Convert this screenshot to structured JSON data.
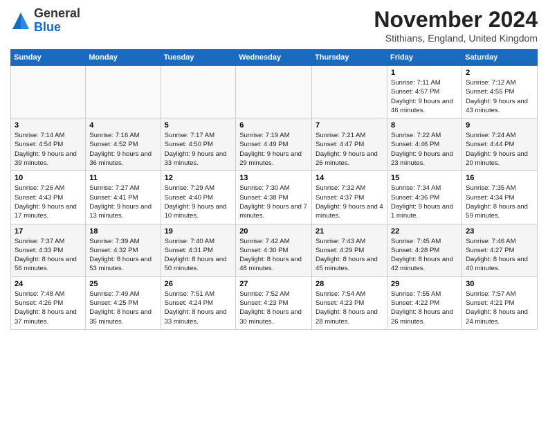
{
  "logo": {
    "general": "General",
    "blue": "Blue"
  },
  "header": {
    "month": "November 2024",
    "location": "Stithians, England, United Kingdom"
  },
  "days_of_week": [
    "Sunday",
    "Monday",
    "Tuesday",
    "Wednesday",
    "Thursday",
    "Friday",
    "Saturday"
  ],
  "weeks": [
    [
      {
        "day": "",
        "info": ""
      },
      {
        "day": "",
        "info": ""
      },
      {
        "day": "",
        "info": ""
      },
      {
        "day": "",
        "info": ""
      },
      {
        "day": "",
        "info": ""
      },
      {
        "day": "1",
        "info": "Sunrise: 7:11 AM\nSunset: 4:57 PM\nDaylight: 9 hours and 46 minutes."
      },
      {
        "day": "2",
        "info": "Sunrise: 7:12 AM\nSunset: 4:55 PM\nDaylight: 9 hours and 43 minutes."
      }
    ],
    [
      {
        "day": "3",
        "info": "Sunrise: 7:14 AM\nSunset: 4:54 PM\nDaylight: 9 hours and 39 minutes."
      },
      {
        "day": "4",
        "info": "Sunrise: 7:16 AM\nSunset: 4:52 PM\nDaylight: 9 hours and 36 minutes."
      },
      {
        "day": "5",
        "info": "Sunrise: 7:17 AM\nSunset: 4:50 PM\nDaylight: 9 hours and 33 minutes."
      },
      {
        "day": "6",
        "info": "Sunrise: 7:19 AM\nSunset: 4:49 PM\nDaylight: 9 hours and 29 minutes."
      },
      {
        "day": "7",
        "info": "Sunrise: 7:21 AM\nSunset: 4:47 PM\nDaylight: 9 hours and 26 minutes."
      },
      {
        "day": "8",
        "info": "Sunrise: 7:22 AM\nSunset: 4:46 PM\nDaylight: 9 hours and 23 minutes."
      },
      {
        "day": "9",
        "info": "Sunrise: 7:24 AM\nSunset: 4:44 PM\nDaylight: 9 hours and 20 minutes."
      }
    ],
    [
      {
        "day": "10",
        "info": "Sunrise: 7:26 AM\nSunset: 4:43 PM\nDaylight: 9 hours and 17 minutes."
      },
      {
        "day": "11",
        "info": "Sunrise: 7:27 AM\nSunset: 4:41 PM\nDaylight: 9 hours and 13 minutes."
      },
      {
        "day": "12",
        "info": "Sunrise: 7:29 AM\nSunset: 4:40 PM\nDaylight: 9 hours and 10 minutes."
      },
      {
        "day": "13",
        "info": "Sunrise: 7:30 AM\nSunset: 4:38 PM\nDaylight: 9 hours and 7 minutes."
      },
      {
        "day": "14",
        "info": "Sunrise: 7:32 AM\nSunset: 4:37 PM\nDaylight: 9 hours and 4 minutes."
      },
      {
        "day": "15",
        "info": "Sunrise: 7:34 AM\nSunset: 4:36 PM\nDaylight: 9 hours and 1 minute."
      },
      {
        "day": "16",
        "info": "Sunrise: 7:35 AM\nSunset: 4:34 PM\nDaylight: 8 hours and 59 minutes."
      }
    ],
    [
      {
        "day": "17",
        "info": "Sunrise: 7:37 AM\nSunset: 4:33 PM\nDaylight: 8 hours and 56 minutes."
      },
      {
        "day": "18",
        "info": "Sunrise: 7:39 AM\nSunset: 4:32 PM\nDaylight: 8 hours and 53 minutes."
      },
      {
        "day": "19",
        "info": "Sunrise: 7:40 AM\nSunset: 4:31 PM\nDaylight: 8 hours and 50 minutes."
      },
      {
        "day": "20",
        "info": "Sunrise: 7:42 AM\nSunset: 4:30 PM\nDaylight: 8 hours and 48 minutes."
      },
      {
        "day": "21",
        "info": "Sunrise: 7:43 AM\nSunset: 4:29 PM\nDaylight: 8 hours and 45 minutes."
      },
      {
        "day": "22",
        "info": "Sunrise: 7:45 AM\nSunset: 4:28 PM\nDaylight: 8 hours and 42 minutes."
      },
      {
        "day": "23",
        "info": "Sunrise: 7:46 AM\nSunset: 4:27 PM\nDaylight: 8 hours and 40 minutes."
      }
    ],
    [
      {
        "day": "24",
        "info": "Sunrise: 7:48 AM\nSunset: 4:26 PM\nDaylight: 8 hours and 37 minutes."
      },
      {
        "day": "25",
        "info": "Sunrise: 7:49 AM\nSunset: 4:25 PM\nDaylight: 8 hours and 35 minutes."
      },
      {
        "day": "26",
        "info": "Sunrise: 7:51 AM\nSunset: 4:24 PM\nDaylight: 8 hours and 33 minutes."
      },
      {
        "day": "27",
        "info": "Sunrise: 7:52 AM\nSunset: 4:23 PM\nDaylight: 8 hours and 30 minutes."
      },
      {
        "day": "28",
        "info": "Sunrise: 7:54 AM\nSunset: 4:23 PM\nDaylight: 8 hours and 28 minutes."
      },
      {
        "day": "29",
        "info": "Sunrise: 7:55 AM\nSunset: 4:22 PM\nDaylight: 8 hours and 26 minutes."
      },
      {
        "day": "30",
        "info": "Sunrise: 7:57 AM\nSunset: 4:21 PM\nDaylight: 8 hours and 24 minutes."
      }
    ]
  ]
}
